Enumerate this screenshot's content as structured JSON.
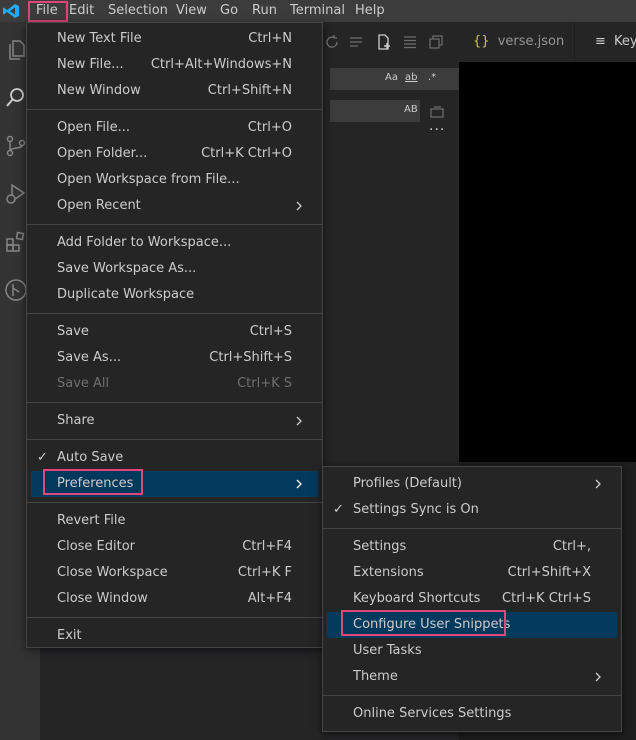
{
  "menubar": {
    "items": [
      "File",
      "Edit",
      "Selection",
      "View",
      "Go",
      "Run",
      "Terminal",
      "Help"
    ]
  },
  "tabs": [
    {
      "icon": "{}",
      "label": "verse.json"
    },
    {
      "icon": "≡",
      "label": "Keyb"
    }
  ],
  "search": {
    "opt_case": "Aa",
    "opt_word": "ab",
    "opt_regex": ".*",
    "opt_preserve": "AB"
  },
  "file_menu": {
    "groups": [
      [
        {
          "label": "New Text File",
          "shortcut": "Ctrl+N"
        },
        {
          "label": "New File...",
          "shortcut": "Ctrl+Alt+Windows+N"
        },
        {
          "label": "New Window",
          "shortcut": "Ctrl+Shift+N"
        }
      ],
      [
        {
          "label": "Open File...",
          "shortcut": "Ctrl+O"
        },
        {
          "label": "Open Folder...",
          "shortcut": "Ctrl+K Ctrl+O"
        },
        {
          "label": "Open Workspace from File...",
          "shortcut": ""
        },
        {
          "label": "Open Recent",
          "shortcut": "",
          "submenu": true
        }
      ],
      [
        {
          "label": "Add Folder to Workspace...",
          "shortcut": ""
        },
        {
          "label": "Save Workspace As...",
          "shortcut": ""
        },
        {
          "label": "Duplicate Workspace",
          "shortcut": ""
        }
      ],
      [
        {
          "label": "Save",
          "shortcut": "Ctrl+S"
        },
        {
          "label": "Save As...",
          "shortcut": "Ctrl+Shift+S"
        },
        {
          "label": "Save All",
          "shortcut": "Ctrl+K S",
          "disabled": true
        }
      ],
      [
        {
          "label": "Share",
          "shortcut": "",
          "submenu": true
        }
      ],
      [
        {
          "label": "Auto Save",
          "shortcut": "",
          "checked": true
        },
        {
          "label": "Preferences",
          "shortcut": "",
          "submenu": true,
          "active": true
        }
      ],
      [
        {
          "label": "Revert File",
          "shortcut": ""
        },
        {
          "label": "Close Editor",
          "shortcut": "Ctrl+F4"
        },
        {
          "label": "Close Workspace",
          "shortcut": "Ctrl+K F"
        },
        {
          "label": "Close Window",
          "shortcut": "Alt+F4"
        }
      ],
      [
        {
          "label": "Exit",
          "shortcut": ""
        }
      ]
    ]
  },
  "preferences_menu": {
    "groups": [
      [
        {
          "label": "Profiles (Default)",
          "shortcut": "",
          "submenu": true
        },
        {
          "label": "Settings Sync is On",
          "shortcut": "",
          "checked": true
        }
      ],
      [
        {
          "label": "Settings",
          "shortcut": "Ctrl+,"
        },
        {
          "label": "Extensions",
          "shortcut": "Ctrl+Shift+X"
        },
        {
          "label": "Keyboard Shortcuts",
          "shortcut": "Ctrl+K Ctrl+S"
        },
        {
          "label": "Configure User Snippets",
          "shortcut": "",
          "active": true
        },
        {
          "label": "User Tasks",
          "shortcut": ""
        },
        {
          "label": "Theme",
          "shortcut": "",
          "submenu": true
        }
      ],
      [
        {
          "label": "Online Services Settings",
          "shortcut": ""
        }
      ]
    ]
  },
  "colors": {
    "highlight": "#e0457b",
    "active_bg": "#04395e",
    "menu_bg": "#252526",
    "menubar_bg": "#3c3c3c",
    "logo": "#23a9f2"
  }
}
